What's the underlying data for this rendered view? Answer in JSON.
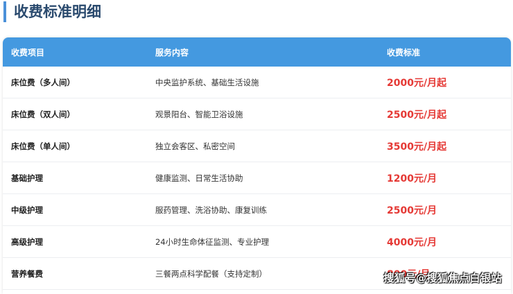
{
  "title": "收费标准明细",
  "headers": [
    "收费项目",
    "服务内容",
    "收费标准"
  ],
  "rows": [
    {
      "item": "床位费（多人间）",
      "service": "中央监护系统、基础生活设施",
      "price": "2000元/月起"
    },
    {
      "item": "床位费（双人间）",
      "service": "观景阳台、智能卫浴设施",
      "price": "2500元/月起"
    },
    {
      "item": "床位费（单人间）",
      "service": "独立会客区、私密空间",
      "price": "3500元/月起"
    },
    {
      "item": "基础护理",
      "service": "健康监测、日常生活协助",
      "price": "1200元/月"
    },
    {
      "item": "中级护理",
      "service": "服药管理、洗浴协助、康复训练",
      "price": "2500元/月"
    },
    {
      "item": "高级护理",
      "service": "24小时生命体征监测、专业护理",
      "price": "4000元/月"
    },
    {
      "item": "营养餐费",
      "service": "三餐两点科学配餐（支持定制）",
      "price": "800元/月"
    }
  ],
  "watermark": "搜狐号@搜狐焦点白银站"
}
